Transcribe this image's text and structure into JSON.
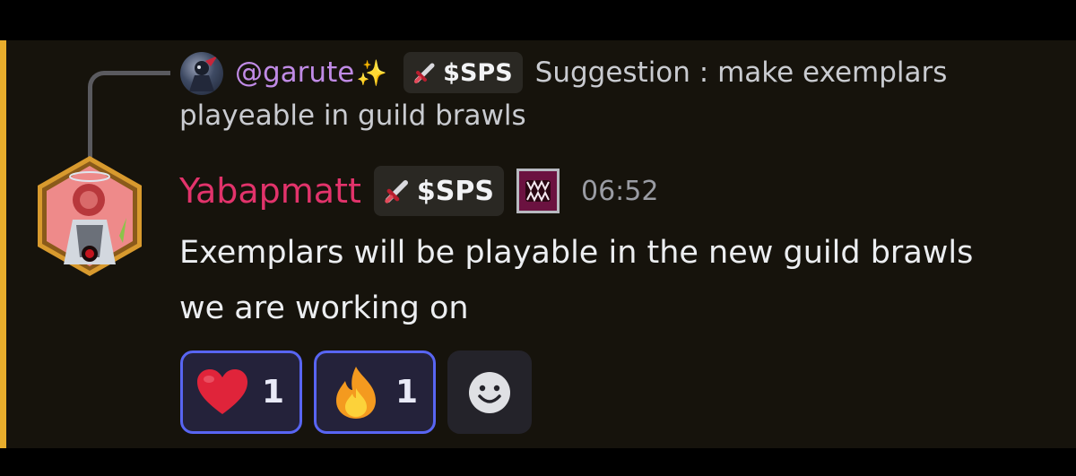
{
  "reply": {
    "username": "@garute",
    "username_emoji": "✨",
    "tag": "$SPS",
    "text_line1": "Suggestion : make exemplars",
    "text_line2": "playeable in guild brawls"
  },
  "message": {
    "author": "Yabapmatt",
    "tag": "$SPS",
    "timestamp": "06:52",
    "line1": "Exemplars will be playable in the new guild brawls",
    "line2": "we are working on"
  },
  "reactions": [
    {
      "emoji": "heart-icon",
      "count": "1"
    },
    {
      "emoji": "fire-icon",
      "count": "1"
    }
  ],
  "colors": {
    "accent_bar": "#e8ad2c",
    "author": "#e2336b",
    "reply_username": "#c08be6",
    "reaction_border": "#5865f2",
    "background": "#16130c"
  },
  "icons": {
    "tag_icon": "sword-icon",
    "badge": "monster-mouth-badge-icon",
    "add_reaction": "add-reaction-smiley-icon"
  }
}
